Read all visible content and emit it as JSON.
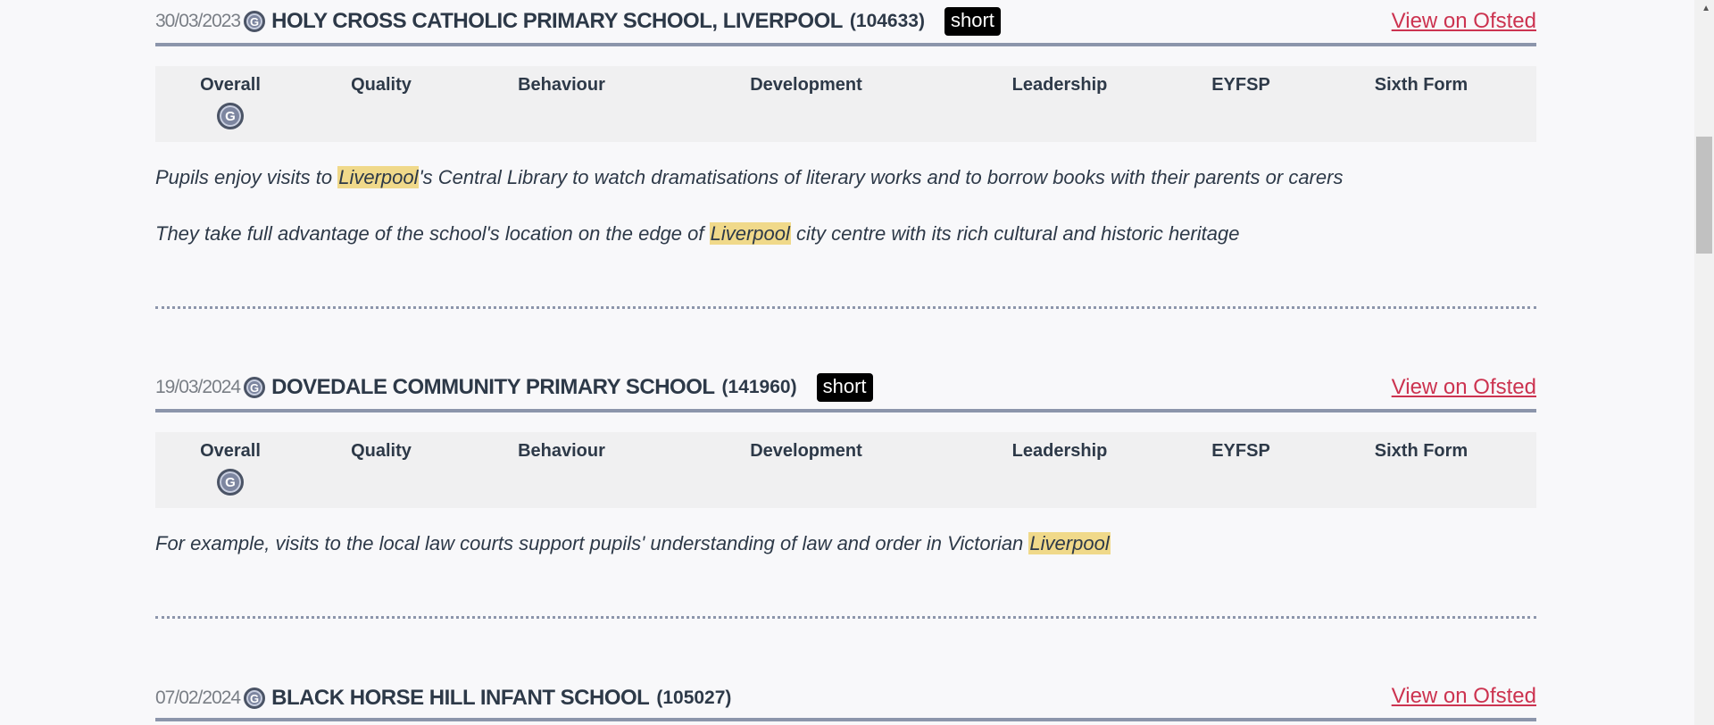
{
  "grade_headers": [
    "Overall",
    "Quality",
    "Behaviour",
    "Development",
    "Leadership",
    "EYFSP",
    "Sixth Form"
  ],
  "schools": [
    {
      "date": "30/03/2023",
      "badge": "G",
      "name": "HOLY CROSS CATHOLIC PRIMARY SCHOOL, LIVERPOOL",
      "urn": "(104633)",
      "tag": "short",
      "link": "View on Ofsted",
      "overall_grade": "G",
      "quotes": [
        {
          "before": "Pupils enjoy visits to ",
          "highlight": "Liverpool",
          "after": "'s Central Library to watch dramatisations of literary works and to borrow books with their parents or carers"
        },
        {
          "before": "They take full advantage of the school's location on the edge of ",
          "highlight": "Liverpool",
          "after": " city centre with its rich cultural and historic heritage"
        }
      ]
    },
    {
      "date": "19/03/2024",
      "badge": "G",
      "name": "DOVEDALE COMMUNITY PRIMARY SCHOOL",
      "urn": "(141960)",
      "tag": "short",
      "link": "View on Ofsted",
      "overall_grade": "G",
      "quotes": [
        {
          "before": "For example, visits to the local law courts support pupils' understanding of law and order in Victorian ",
          "highlight": "Liverpool",
          "after": ""
        }
      ]
    },
    {
      "date": "07/02/2024",
      "badge": "G",
      "name": "BLACK HORSE HILL INFANT SCHOOL",
      "urn": "(105027)",
      "link": "View on Ofsted"
    }
  ]
}
